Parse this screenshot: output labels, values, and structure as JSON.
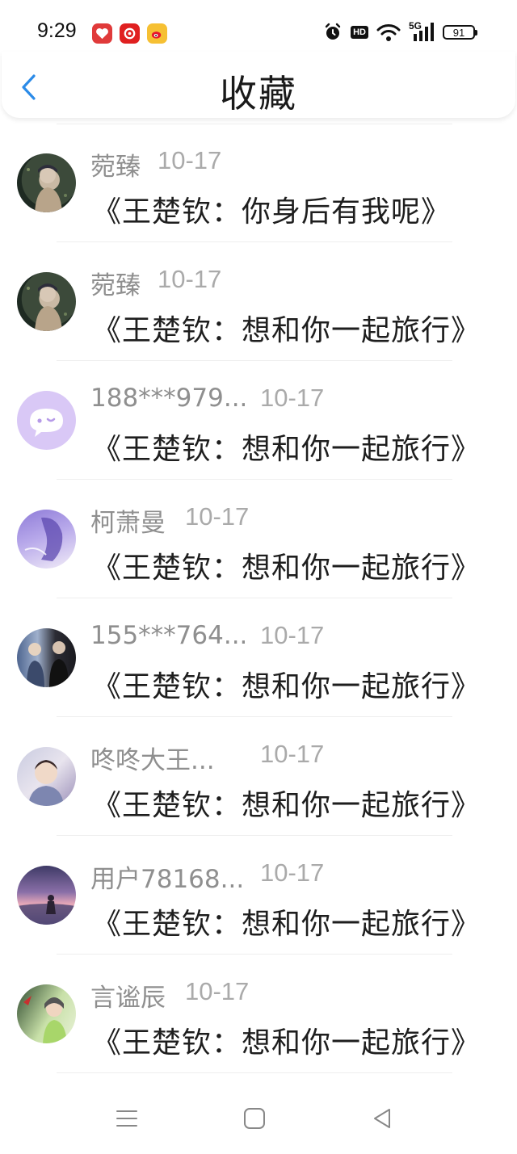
{
  "status_bar": {
    "time": "9:29",
    "network": "5G",
    "hd": "HD",
    "battery": "91"
  },
  "header": {
    "title": "收藏"
  },
  "items": [
    {
      "name": "菀臻",
      "date": "10-17",
      "title": "《王楚钦：你身后有我呢》",
      "date_offset": "short"
    },
    {
      "name": "菀臻",
      "date": "10-17",
      "title": "《王楚钦：想和你一起旅行》",
      "date_offset": "short"
    },
    {
      "name": "188***979...",
      "date": "10-17",
      "title": "《王楚钦：想和你一起旅行》",
      "date_offset": "long"
    },
    {
      "name": "柯萧曼",
      "date": "10-17",
      "title": "《王楚钦：想和你一起旅行》",
      "date_offset": "mid"
    },
    {
      "name": "155***764...",
      "date": "10-17",
      "title": "《王楚钦：想和你一起旅行》",
      "date_offset": "long"
    },
    {
      "name": "咚咚大王...",
      "date": "10-17",
      "title": "《王楚钦：想和你一起旅行》",
      "date_offset": "long"
    },
    {
      "name": "用户78168...",
      "date": "10-17",
      "title": "《王楚钦：想和你一起旅行》",
      "date_offset": "long"
    },
    {
      "name": "言谧辰",
      "date": "10-17",
      "title": "《王楚钦：想和你一起旅行》",
      "date_offset": "mid"
    }
  ],
  "colors": {
    "accent": "#2b8be8",
    "name_text": "#8f8f8f",
    "date_text": "#aaaaaa",
    "title_text": "#1e1e1e"
  }
}
